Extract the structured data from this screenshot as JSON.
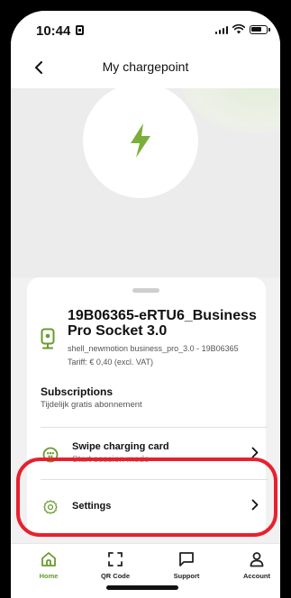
{
  "status_bar": {
    "time": "10:44"
  },
  "header": {
    "title": "My chargepoint"
  },
  "charger": {
    "name": "19B06365-eRTU6_Business Pro Socket 3.0",
    "id_line": "shell_newmotion business_pro_3.0 - 19B06365",
    "tariff": "Tariff: € 0,40 (excl. VAT)"
  },
  "subscriptions": {
    "title": "Subscriptions",
    "value": "Tijdelijk gratis abonnement"
  },
  "swipe_card": {
    "label": "Swipe charging card",
    "sublabel": "Start session mode"
  },
  "settings": {
    "label": "Settings"
  },
  "nav": {
    "items": [
      {
        "label": "Home",
        "icon": "home-icon",
        "active": true
      },
      {
        "label": "QR Code",
        "icon": "qr-scan-icon",
        "active": false
      },
      {
        "label": "Support",
        "icon": "chat-icon",
        "active": false
      },
      {
        "label": "Account",
        "icon": "user-icon",
        "active": false
      }
    ]
  },
  "colors": {
    "accent_green": "#6a9a2e",
    "lightning_green": "#7cae3a",
    "highlight_red": "#e8202e"
  }
}
